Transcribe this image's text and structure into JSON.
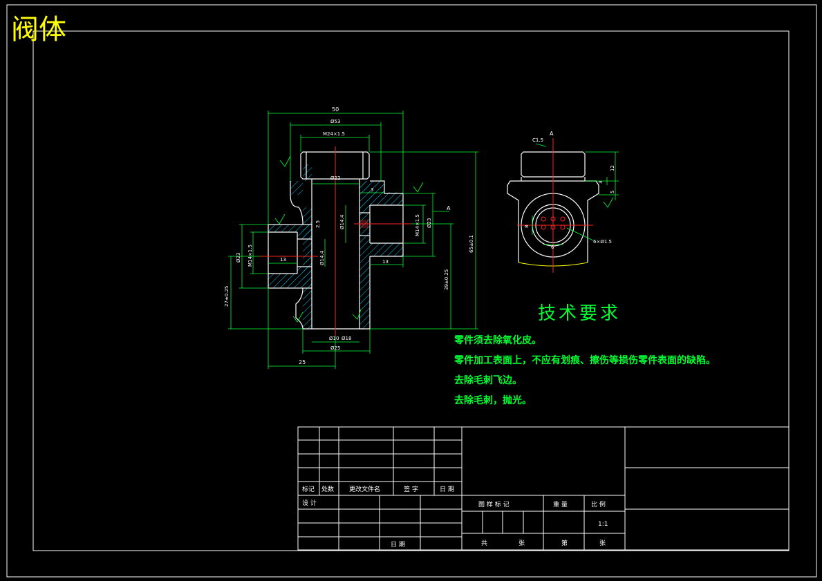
{
  "title": "阀体",
  "colors": {
    "background": "#000000",
    "outline": "#ffffff",
    "dimension": "#00ff33",
    "hatch": "#00ccff",
    "centerline": "#ff2222",
    "title": "#ffff00",
    "text": "#00ff33"
  },
  "dimensions": {
    "d50": "50",
    "d53": "Ø53",
    "m24": "M24×1.5",
    "d22": "Ø22",
    "d3": "3",
    "d14_4a": "Ø14.4",
    "m14a": "M14×1.5",
    "d23a": "Ø23",
    "d13a": "13",
    "d2_5a": "2.5",
    "d65": "65±0.1",
    "d39": "39±0.25",
    "d27": "27±0.25",
    "m14b": "M14×1.5",
    "d23b": "Ø23",
    "d13b": "13",
    "d14_4b": "Ø14.4",
    "d10": "Ø10",
    "d18": "Ø18",
    "d25": "Ø25",
    "w25": "25",
    "chamfer": "C1.5",
    "viewA1": "A",
    "viewA2": "A",
    "holes": "6×Ø1.5",
    "d12": "12",
    "d3b": "3",
    "d5": "5",
    "d8": "8",
    "d6": "6"
  },
  "requirements": {
    "heading": "技术要求",
    "items": [
      "零件须去除氧化皮。",
      "零件加工表面上，不应有划痕、擦伤等损伤零件表面的缺陷。",
      "去除毛刺飞边。",
      "去除毛刺，抛光。"
    ]
  },
  "title_block": {
    "mark": "标记",
    "count": "处数",
    "doc": "更改文件名",
    "sign": "签 字",
    "date": "日 期",
    "design": "设 计",
    "date2": "日 期",
    "drawing_mark": "图 样 标 记",
    "weight": "重 量",
    "scale": "比 例",
    "scale_value": "1:1",
    "total": "共",
    "sheet": "张",
    "page": "第",
    "sheet2": "张"
  }
}
